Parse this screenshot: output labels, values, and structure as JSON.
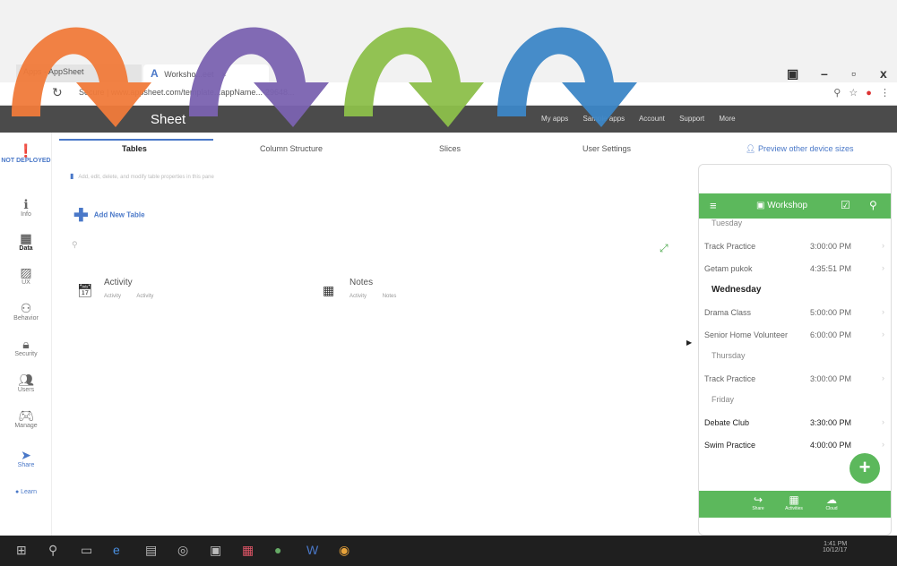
{
  "browser": {
    "tabs": [
      {
        "label": "Apps - AppSheet"
      },
      {
        "label": "Worksho...eet"
      }
    ],
    "tab_close": "×",
    "app_logo": "A",
    "address": "Secure | www.appsheet.com/template...appName...-29648...",
    "window_controls": {
      "minimize": "–",
      "maximize": "▫",
      "close": "x"
    }
  },
  "app": {
    "title": "Sheet",
    "topnav": [
      "My apps",
      "Sample apps",
      "Account",
      "Support",
      "More"
    ]
  },
  "rail": {
    "items": [
      {
        "label": "NOT DEPLOYED",
        "icon": "alert-icon"
      },
      {
        "label": "Info",
        "icon": "info-icon"
      },
      {
        "label": "Data",
        "icon": "table-icon"
      },
      {
        "label": "UX",
        "icon": "image-icon"
      },
      {
        "label": "Behavior",
        "icon": "flow-icon"
      },
      {
        "label": "Security",
        "icon": "lock-icon"
      },
      {
        "label": "Users",
        "icon": "users-icon"
      },
      {
        "label": "Manage",
        "icon": "gamepad-icon"
      },
      {
        "label": "Share",
        "icon": "send-icon"
      },
      {
        "label": "Learn",
        "icon": "dot-icon"
      }
    ]
  },
  "subtabs": [
    {
      "label": "Tables"
    },
    {
      "label": "Column Structure"
    },
    {
      "label": "Slices"
    },
    {
      "label": "User Settings"
    }
  ],
  "preview_link": "Preview other device sizes",
  "main": {
    "hint": "Add, edit, delete, and modify table properties in this pane",
    "add_table": "Add New Table",
    "tables": [
      {
        "name": "Activity",
        "meta": [
          "Activity",
          "Activity"
        ]
      },
      {
        "name": "Notes",
        "meta": [
          "Activity",
          "Notes"
        ]
      }
    ]
  },
  "phone": {
    "title": "Workshop",
    "rows": [
      {
        "type": "day",
        "label": "Tuesday",
        "bold": false
      },
      {
        "type": "item",
        "name": "Track Practice",
        "time": "3:00:00 PM",
        "bold": false
      },
      {
        "type": "item",
        "name": "Getam pukok",
        "time": "4:35:51 PM",
        "bold": false
      },
      {
        "type": "day",
        "label": "Wednesday",
        "bold": true
      },
      {
        "type": "item",
        "name": "Drama Class",
        "time": "5:00:00 PM",
        "bold": false
      },
      {
        "type": "item",
        "name": "Senior Home Volunteer",
        "time": "6:00:00 PM",
        "bold": false
      },
      {
        "type": "day",
        "label": "Thursday",
        "bold": false
      },
      {
        "type": "item",
        "name": "Track Practice",
        "time": "3:00:00 PM",
        "bold": false
      },
      {
        "type": "day",
        "label": "Friday",
        "bold": false
      },
      {
        "type": "item",
        "name": "Debate Club",
        "time": "3:30:00 PM",
        "bold": true
      },
      {
        "type": "item",
        "name": "Swim Practice",
        "time": "4:00:00 PM",
        "bold": true
      }
    ],
    "bottom_nav": [
      "Share",
      "Activities",
      "Cloud"
    ]
  },
  "taskbar": {
    "time": "1:41 PM",
    "date": "10/12/17"
  },
  "colors": {
    "arrow_orange": "#f07a3a",
    "arrow_purple": "#7a62b0",
    "arrow_green": "#8cbf4a",
    "arrow_blue": "#3c86c6",
    "appsheet_green": "#5cb85c",
    "header_dark": "#4b4b4b"
  }
}
